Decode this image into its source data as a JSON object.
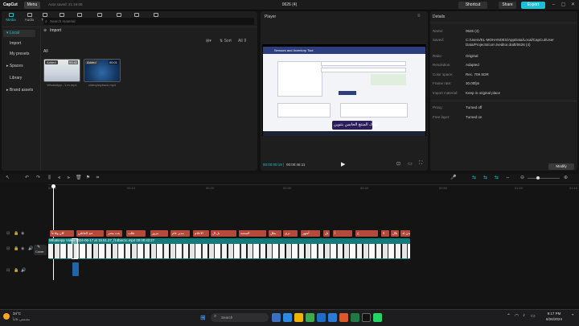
{
  "titlebar": {
    "logo": "CapCut",
    "menu": "Menu",
    "autosave": "Auto saved: 21:16:08",
    "project_title": "0626 (4)",
    "shortcut": "Shortcut",
    "share": "Share",
    "export": "Export"
  },
  "media": {
    "tabs": [
      "Media",
      "Audio",
      "Text",
      "Stickers",
      "Effects",
      "Transitions",
      "Captions",
      "Filters",
      "Adjustment"
    ],
    "sidebar": {
      "local": "Local",
      "import": "Import",
      "my_presets": "My presets",
      "spaces": "Spaces",
      "library": "Library",
      "brand_assets": "Brand assets"
    },
    "search_placeholder": "Search material",
    "import_label": "Import",
    "sort": "Sort",
    "all_filter": "All",
    "all_heading": "All",
    "clips": [
      {
        "badge": "Added",
        "duration": "00:42",
        "name": "WhatsApp...1.m.mp4"
      },
      {
        "badge": "Added",
        "duration": "00:01",
        "name": "videoplayback.mp4"
      }
    ]
  },
  "player": {
    "title": "Player",
    "time_current": "00:00:00:19",
    "time_total": "00:00:46:11",
    "screen": {
      "header": "Sensors and Inventory Tool",
      "caption_text": "تهتاك المنتج الحاسن بتنوين"
    }
  },
  "details": {
    "title": "Details",
    "rows": [
      {
        "label": "Name:",
        "value": "0626 (4)"
      },
      {
        "label": "Saved:",
        "value": "C:/Users/EL-MOHANDES/AppData/Local/CapCut/User Data/Projects/com.lveditor.draft/0626 (4)"
      },
      {
        "label": "Ratio:",
        "value": "Original"
      },
      {
        "label": "Resolution:",
        "value": "Adapted"
      },
      {
        "label": "Color space:",
        "value": "Rec. 709 SDR"
      },
      {
        "label": "Frame rate:",
        "value": "30.00fps"
      },
      {
        "label": "Import material:",
        "value": "Keep in original place"
      },
      {
        "label": "Proxy:",
        "value": "Turned off"
      },
      {
        "label": "Free layer:",
        "value": "Turned on"
      }
    ],
    "modify": "Modify"
  },
  "timeline": {
    "ticks": [
      "00:00",
      "00:10",
      "00:20",
      "00:30",
      "00:40",
      "00:50",
      "01:00",
      "01:10"
    ],
    "video_label": "WhatsApp Video 2024-06-17 at 15.51.27_f14bac1c.mp4  00:00:42:27",
    "cover": "Cover",
    "text_clips": [
      "كان وقاعاً",
      "عبد العاطي",
      "بثت مصر",
      "طلب",
      "مرور",
      "مدير عام",
      "الاعلام",
      "بل ال",
      "المنصة",
      "يطل",
      "ترى",
      "أشهر",
      "تل",
      "أ",
      "ح",
      "لا",
      "بلال",
      "قدن لد"
    ]
  },
  "taskbar": {
    "weather_temp": "34°C",
    "weather_desc": "مشمس غالباً",
    "search": "Search",
    "time": "9:17 PM",
    "date": "6/26/2024"
  },
  "colors": {
    "accent": "#1ec0d6",
    "video_track": "#147a7a",
    "text_clip": "#b34a3a"
  }
}
